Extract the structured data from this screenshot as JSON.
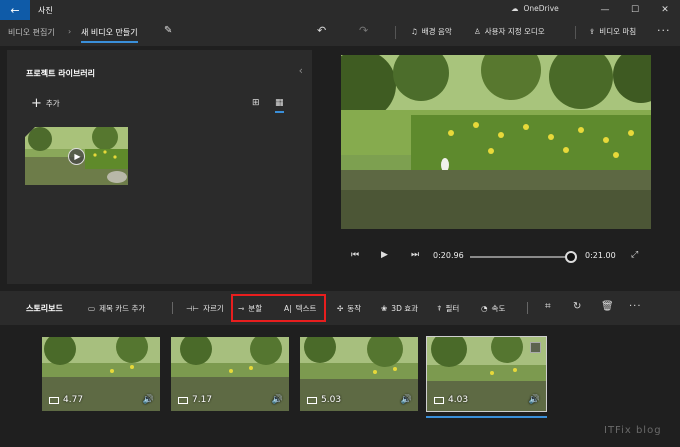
{
  "app": {
    "title": "사진",
    "back_icon": "back-arrow-icon"
  },
  "window": {
    "onedrive_label": "OneDrive",
    "controls": [
      "minimize-icon",
      "maximize-icon",
      "close-icon"
    ]
  },
  "breadcrumb": {
    "parent": "비디오 편집기",
    "current": "새 비디오 만들기"
  },
  "toolbar": {
    "background_music": "배경 음악",
    "custom_audio": "사용자 지정 오디오",
    "finish_video": "비디오 마침",
    "more": "···"
  },
  "library": {
    "title": "프로젝트 라이브러리",
    "add_label": "추가"
  },
  "player": {
    "current_time": "0:20.96",
    "total_time": "0:21.00",
    "progress_fraction": 0.998
  },
  "storyboard": {
    "title": "스토리보드",
    "title_card": "제목 카드 추가",
    "trim": "자르기",
    "split": "분할",
    "text": "텍스트",
    "motion": "동작",
    "effects_3d": "3D 효과",
    "filter": "필터",
    "speed": "속도",
    "more": "···",
    "clips": [
      {
        "duration": "4.77"
      },
      {
        "duration": "7.17"
      },
      {
        "duration": "5.03"
      },
      {
        "duration": "4.03"
      }
    ]
  },
  "watermark": "ITFix blog",
  "colors": {
    "accent": "#3a8fd9",
    "highlight": "#e81e1e",
    "back_button": "#0f5ba8"
  }
}
